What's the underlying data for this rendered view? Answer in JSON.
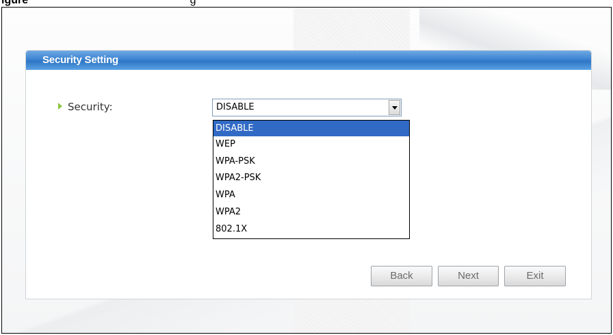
{
  "caption": {
    "figure_label": "igure",
    "figure_text": "g"
  },
  "panel": {
    "title": "Security Setting"
  },
  "security": {
    "label": "Security:",
    "selected_value": "DISABLE",
    "options": [
      "DISABLE",
      "WEP",
      "WPA-PSK",
      "WPA2-PSK",
      "WPA",
      "WPA2",
      "802.1X"
    ],
    "highlighted_index": 0
  },
  "buttons": {
    "back": "Back",
    "next": "Next",
    "exit": "Exit"
  },
  "colors": {
    "header_blue": "#3d84d1",
    "highlight": "#316ac5",
    "arrow_green": "#8cc63f"
  },
  "icons": {
    "label_marker": "arrow-right-icon",
    "select_button": "chevron-down-icon"
  }
}
